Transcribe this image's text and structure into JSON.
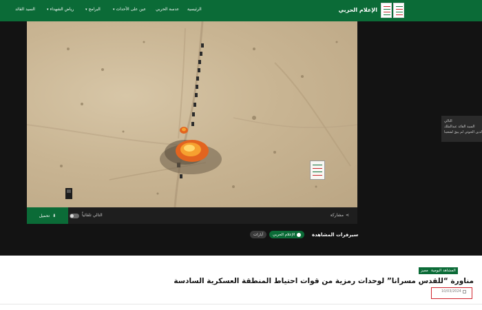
{
  "brand": {
    "name": "الإعلام الحربي"
  },
  "nav": {
    "items": [
      {
        "label": "الرئيسية",
        "has_dropdown": false
      },
      {
        "label": "عدسة الحربي",
        "has_dropdown": false
      },
      {
        "label": "عين على الأحداث",
        "has_dropdown": true
      },
      {
        "label": "البرامج",
        "has_dropdown": true
      },
      {
        "label": "رياض الشهداء",
        "has_dropdown": true
      },
      {
        "label": "السيد القائد",
        "has_dropdown": false
      }
    ],
    "chevron": "▾"
  },
  "video": {
    "watermark_icon": "media-logo-watermark",
    "scene_icon": "aerial-explosion-scene"
  },
  "video_toolbar": {
    "download_label": "تحميل",
    "download_icon": "download-icon",
    "autoplay_label": "التالي تلقائياً",
    "autoplay_on": false,
    "share_label": "مشاركة",
    "share_icon": "share-icon"
  },
  "tags": {
    "label": "سيرفرات المشاهدة",
    "items": [
      {
        "label": "الإعلام الحربي",
        "active": true
      },
      {
        "label": "آيارات",
        "active": false
      }
    ]
  },
  "side_card": {
    "lines": [
      "التالي",
      "السيد القائد عبدالملك",
      "بدرالدين الحوثي لم يبقَ لشعبنا..."
    ]
  },
  "article": {
    "badges": [
      "المشاهد اليومية",
      "مميز"
    ],
    "title": "مناورة “للقدس مسرانا” لوحدات رمزية من قوات احتياط المنطقة العسكرية السادسة",
    "date": "10/03/2024"
  },
  "colors": {
    "primary": "#0b6b37",
    "stage": "#131313",
    "highlight": "#d0202a"
  }
}
